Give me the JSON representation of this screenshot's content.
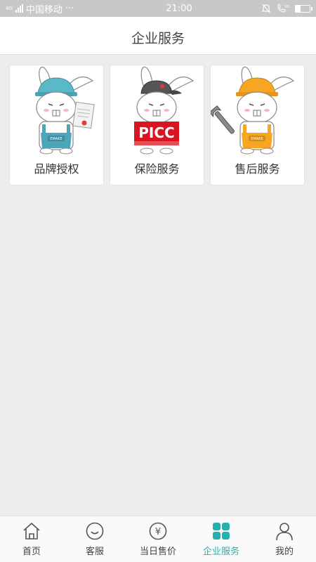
{
  "status_bar": {
    "network": "4G",
    "carrier": "中国移动",
    "dots": "···",
    "time": "21:00"
  },
  "header": {
    "title": "企业服务"
  },
  "cards": [
    {
      "label": "品牌授权",
      "icon": "brand-authorization-rabbit-icon"
    },
    {
      "label": "保险服务",
      "icon": "insurance-rabbit-icon",
      "badge_text": "PICC"
    },
    {
      "label": "售后服务",
      "icon": "after-sales-rabbit-icon"
    }
  ],
  "tabbar": {
    "active_index": 3,
    "active_color": "#2aaeae",
    "items": [
      {
        "label": "首页",
        "icon": "home-icon"
      },
      {
        "label": "客服",
        "icon": "customer-service-icon"
      },
      {
        "label": "当日售价",
        "icon": "yuan-price-icon",
        "glyph": "¥"
      },
      {
        "label": "企业服务",
        "icon": "enterprise-grid-icon"
      },
      {
        "label": "我的",
        "icon": "profile-icon"
      }
    ]
  }
}
